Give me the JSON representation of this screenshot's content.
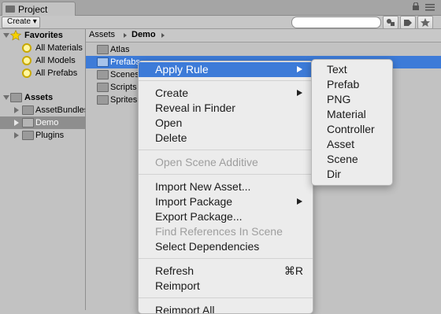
{
  "window": {
    "tab_title": "Project"
  },
  "toolbar": {
    "create_label": "Create ▾"
  },
  "favorites": {
    "label": "Favorites",
    "items": [
      "All Materials",
      "All Models",
      "All Prefabs"
    ]
  },
  "assets_tree": {
    "label": "Assets",
    "items": [
      "AssetBundles",
      "Demo",
      "Plugins"
    ],
    "selected": "Demo"
  },
  "breadcrumb": [
    "Assets",
    "Demo"
  ],
  "asset_list": [
    "Atlas",
    "Prefabs",
    "Scenes",
    "Scripts",
    "Sprites"
  ],
  "context_menu": {
    "apply_rule": "Apply Rule",
    "create": "Create",
    "reveal": "Reveal in Finder",
    "open": "Open",
    "delete": "Delete",
    "open_scene_additive": "Open Scene Additive",
    "import_new_asset": "Import New Asset...",
    "import_package": "Import Package",
    "export_package": "Export Package...",
    "find_references": "Find References In Scene",
    "select_dependencies": "Select Dependencies",
    "refresh": "Refresh",
    "refresh_shortcut": "⌘R",
    "reimport": "Reimport",
    "reimport_all": "Reimport All"
  },
  "submenu": [
    "Text",
    "Prefab",
    "PNG",
    "Material",
    "Controller",
    "Asset",
    "Scene",
    "Dir"
  ],
  "colors": {
    "selection": "#3d7bd8",
    "panel": "#c2c2c2",
    "menu_bg": "#ececec"
  }
}
